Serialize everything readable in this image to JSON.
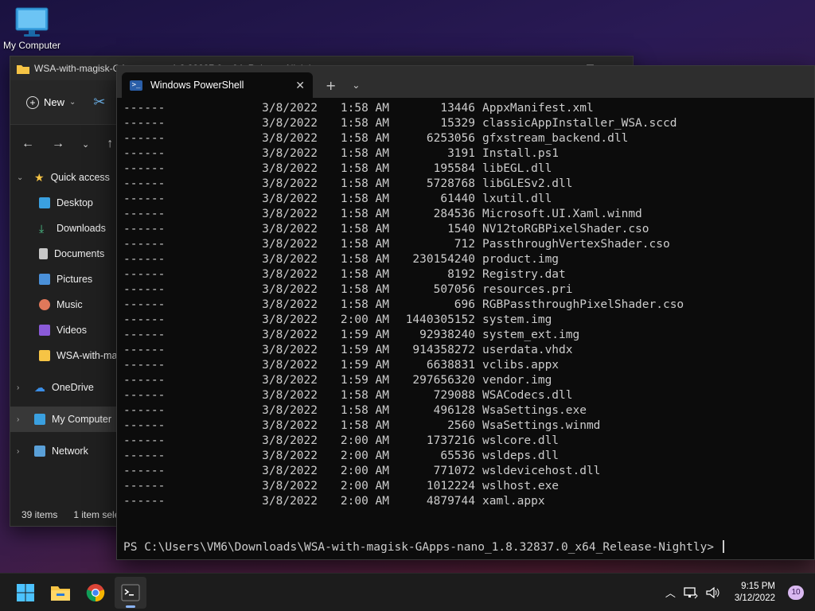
{
  "desktop": {
    "icon_label": "My Computer"
  },
  "explorer": {
    "title": "WSA-with-magisk-GApps-nano_1.8.32837.0_x64_Release-Nightly",
    "toolbar": {
      "new_label": "New",
      "new_chevron": "⌄"
    },
    "sidebar": {
      "quick_access": "Quick access",
      "items": [
        "Desktop",
        "Downloads",
        "Documents",
        "Pictures",
        "Music",
        "Videos",
        "WSA-with-magisk-GApps"
      ],
      "onedrive": "OneDrive",
      "my_computer": "My Computer",
      "network": "Network"
    },
    "status": {
      "count": "39 items",
      "selected": "1 item selected"
    }
  },
  "terminal": {
    "tab_title": "Windows PowerShell",
    "rows": [
      {
        "mode": "------",
        "date": "3/8/2022",
        "time": "1:58 AM",
        "size": "13446",
        "name": "AppxManifest.xml"
      },
      {
        "mode": "------",
        "date": "3/8/2022",
        "time": "1:58 AM",
        "size": "15329",
        "name": "classicAppInstaller_WSA.sccd"
      },
      {
        "mode": "------",
        "date": "3/8/2022",
        "time": "1:58 AM",
        "size": "6253056",
        "name": "gfxstream_backend.dll"
      },
      {
        "mode": "------",
        "date": "3/8/2022",
        "time": "1:58 AM",
        "size": "3191",
        "name": "Install.ps1"
      },
      {
        "mode": "------",
        "date": "3/8/2022",
        "time": "1:58 AM",
        "size": "195584",
        "name": "libEGL.dll"
      },
      {
        "mode": "------",
        "date": "3/8/2022",
        "time": "1:58 AM",
        "size": "5728768",
        "name": "libGLESv2.dll"
      },
      {
        "mode": "------",
        "date": "3/8/2022",
        "time": "1:58 AM",
        "size": "61440",
        "name": "lxutil.dll"
      },
      {
        "mode": "------",
        "date": "3/8/2022",
        "time": "1:58 AM",
        "size": "284536",
        "name": "Microsoft.UI.Xaml.winmd"
      },
      {
        "mode": "------",
        "date": "3/8/2022",
        "time": "1:58 AM",
        "size": "1540",
        "name": "NV12toRGBPixelShader.cso"
      },
      {
        "mode": "------",
        "date": "3/8/2022",
        "time": "1:58 AM",
        "size": "712",
        "name": "PassthroughVertexShader.cso"
      },
      {
        "mode": "------",
        "date": "3/8/2022",
        "time": "1:58 AM",
        "size": "230154240",
        "name": "product.img"
      },
      {
        "mode": "------",
        "date": "3/8/2022",
        "time": "1:58 AM",
        "size": "8192",
        "name": "Registry.dat"
      },
      {
        "mode": "------",
        "date": "3/8/2022",
        "time": "1:58 AM",
        "size": "507056",
        "name": "resources.pri"
      },
      {
        "mode": "------",
        "date": "3/8/2022",
        "time": "1:58 AM",
        "size": "696",
        "name": "RGBPassthroughPixelShader.cso"
      },
      {
        "mode": "------",
        "date": "3/8/2022",
        "time": "2:00 AM",
        "size": "1440305152",
        "name": "system.img"
      },
      {
        "mode": "------",
        "date": "3/8/2022",
        "time": "1:59 AM",
        "size": "92938240",
        "name": "system_ext.img"
      },
      {
        "mode": "------",
        "date": "3/8/2022",
        "time": "1:59 AM",
        "size": "914358272",
        "name": "userdata.vhdx"
      },
      {
        "mode": "------",
        "date": "3/8/2022",
        "time": "1:59 AM",
        "size": "6638831",
        "name": "vclibs.appx"
      },
      {
        "mode": "------",
        "date": "3/8/2022",
        "time": "1:59 AM",
        "size": "297656320",
        "name": "vendor.img"
      },
      {
        "mode": "------",
        "date": "3/8/2022",
        "time": "1:58 AM",
        "size": "729088",
        "name": "WSACodecs.dll"
      },
      {
        "mode": "------",
        "date": "3/8/2022",
        "time": "1:58 AM",
        "size": "496128",
        "name": "WsaSettings.exe"
      },
      {
        "mode": "------",
        "date": "3/8/2022",
        "time": "1:58 AM",
        "size": "2560",
        "name": "WsaSettings.winmd"
      },
      {
        "mode": "------",
        "date": "3/8/2022",
        "time": "2:00 AM",
        "size": "1737216",
        "name": "wslcore.dll"
      },
      {
        "mode": "------",
        "date": "3/8/2022",
        "time": "2:00 AM",
        "size": "65536",
        "name": "wsldeps.dll"
      },
      {
        "mode": "------",
        "date": "3/8/2022",
        "time": "2:00 AM",
        "size": "771072",
        "name": "wsldevicehost.dll"
      },
      {
        "mode": "------",
        "date": "3/8/2022",
        "time": "2:00 AM",
        "size": "1012224",
        "name": "wslhost.exe"
      },
      {
        "mode": "------",
        "date": "3/8/2022",
        "time": "2:00 AM",
        "size": "4879744",
        "name": "xaml.appx"
      }
    ],
    "prompt": "PS C:\\Users\\VM6\\Downloads\\WSA-with-magisk-GApps-nano_1.8.32837.0_x64_Release-Nightly> "
  },
  "taskbar": {
    "time": "9:15 PM",
    "date": "3/12/2022",
    "notification_count": "10"
  },
  "icons": {
    "start": "windows-start-icon",
    "explorer": "file-explorer-icon",
    "chrome": "chrome-icon",
    "terminal": "terminal-icon"
  }
}
